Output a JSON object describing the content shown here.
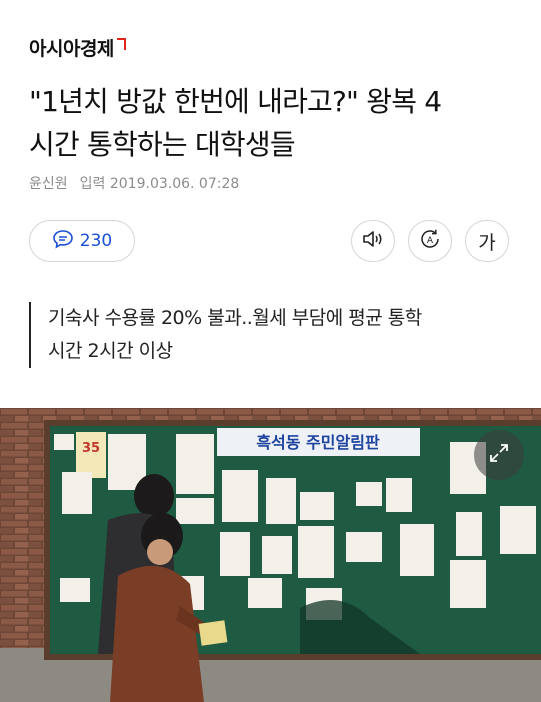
{
  "header": {
    "logo_text": "아시아경제"
  },
  "article": {
    "headline_line1": "\"1년치 방값 한번에 내라고?\" 왕복 4",
    "headline_line2": "시간 통학하는 대학생들",
    "author": "윤신원",
    "date_label": "입력",
    "date": "2019.03.06. 07:28",
    "summary_line1": "기숙사 수용률 20% 불과..월세 부담에 평균 통학",
    "summary_line2": "시간 2시간 이상"
  },
  "actions": {
    "comment_count": "230",
    "font_button_label": "가"
  },
  "photo": {
    "board_title": "흑석동 주민알림판",
    "poster_number": "35"
  },
  "colors": {
    "brand_red": "#e2231a",
    "accent_blue": "#1a4fd6",
    "board_green": "#1f5a42"
  }
}
